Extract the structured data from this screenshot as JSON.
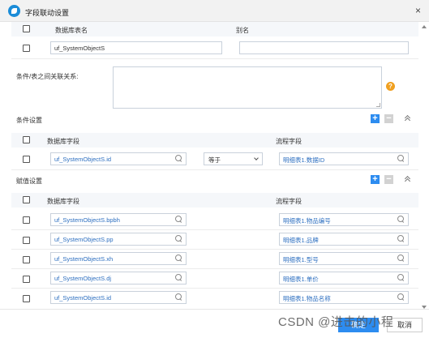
{
  "dialog": {
    "title": "字段联动设置",
    "close_symbol": "×"
  },
  "table_section": {
    "header": {
      "db_table_name": "数据库表名",
      "alias": "别名"
    },
    "row": {
      "table_name_value": "uf_SystemObjectS",
      "alias_value": ""
    }
  },
  "condition_relation": {
    "label": "条件/表之间关联关系:",
    "value": "",
    "help_symbol": "?"
  },
  "condition_settings": {
    "title": "条件设置",
    "header": {
      "db_field": "数据库字段",
      "flow_field": "流程字段"
    },
    "row": {
      "db_field": "uf_SystemObjectS.id",
      "operator": "等于",
      "flow_field": "明细表1.数据ID"
    }
  },
  "assignment_settings": {
    "title": "赋值设置",
    "header": {
      "db_field": "数据库字段",
      "flow_field": "流程字段"
    },
    "rows": [
      {
        "db_field": "uf_SystemObjectS.bpbh",
        "flow_field": "明细表1.物品编号"
      },
      {
        "db_field": "uf_SystemObjectS.pp",
        "flow_field": "明细表1.品牌"
      },
      {
        "db_field": "uf_SystemObjectS.xh",
        "flow_field": "明细表1.型号"
      },
      {
        "db_field": "uf_SystemObjectS.dj",
        "flow_field": "明细表1.单价"
      },
      {
        "db_field": "uf_SystemObjectS.id",
        "flow_field": "明细表1.物品名称"
      }
    ]
  },
  "footer": {
    "confirm_label": "确定",
    "cancel_label": "取消"
  },
  "watermark": "CSDN @进击的小程",
  "colors": {
    "accent": "#2d8cf0",
    "link_text": "#2d6fc0",
    "help": "#f0a020"
  }
}
